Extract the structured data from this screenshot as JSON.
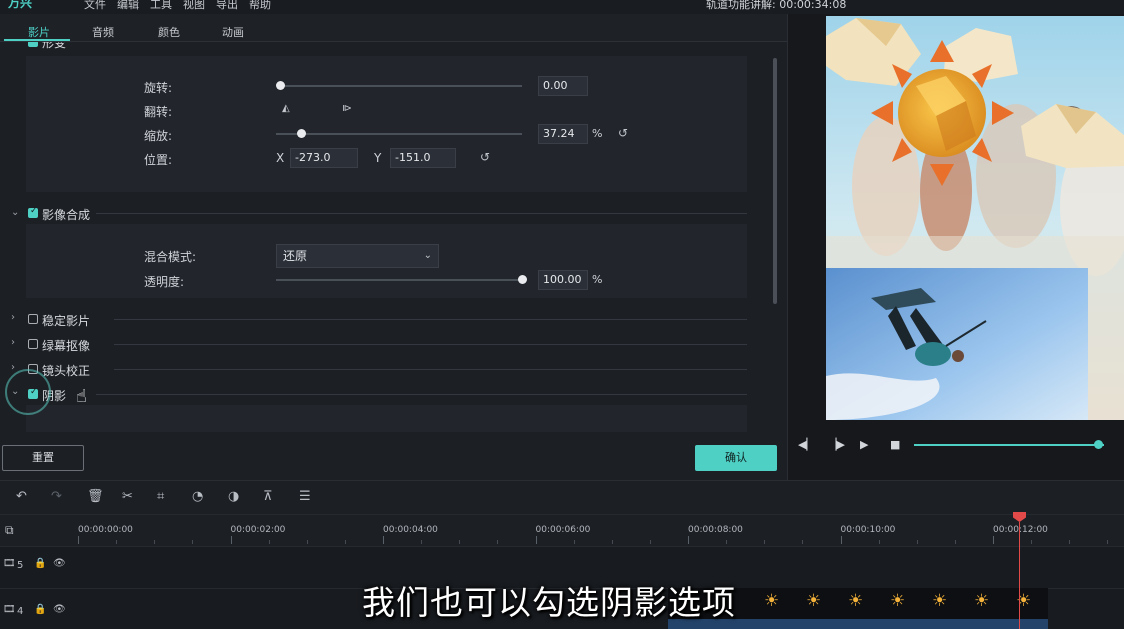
{
  "menu": {
    "logo": "万兴",
    "items": [
      "文件",
      "编辑",
      "工具",
      "视图",
      "导出",
      "帮助"
    ],
    "project_time_label": "轨道功能讲解:",
    "project_time": "00:00:34:08"
  },
  "tabs": [
    "影片",
    "音频",
    "颜色",
    "动画"
  ],
  "transform": {
    "partial_title": "形变",
    "rotate_label": "旋转:",
    "rotate_value": "0.00",
    "rotate_level": 0.0,
    "flip_label": "翻转:",
    "scale_label": "缩放:",
    "scale_value": "37.24",
    "scale_unit": "%",
    "scale_level": 0.1,
    "position_label": "位置:",
    "x_label": "X",
    "x_value": "-273.0",
    "y_label": "Y",
    "y_value": "-151.0"
  },
  "compositing": {
    "title": "影像合成",
    "checked": true,
    "blend_label": "混合模式:",
    "blend_value": "还原",
    "opacity_label": "透明度:",
    "opacity_value": "100.00",
    "opacity_unit": "%",
    "opacity_level": 1.0
  },
  "sections": [
    {
      "title": "稳定影片",
      "checked": false
    },
    {
      "title": "绿幕抠像",
      "checked": false
    },
    {
      "title": "镜头校正",
      "checked": false
    },
    {
      "title": "阴影",
      "checked": true
    }
  ],
  "buttons": {
    "reset": "重置",
    "ok": "确认"
  },
  "preview": {
    "progress_level": 0.97
  },
  "ruler": {
    "labels": [
      "00:00:00:00",
      "00:00:02:00",
      "00:00:04:00",
      "00:00:06:00",
      "00:00:08:00",
      "00:00:10:00",
      "00:00:12:00"
    ]
  },
  "tracks": [
    {
      "number": "5"
    },
    {
      "number": "4"
    }
  ],
  "subtitle": "我们也可以勾选阴影选项"
}
